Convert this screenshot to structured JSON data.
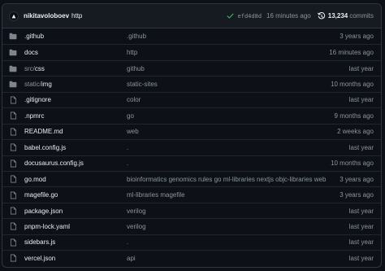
{
  "latest_commit": {
    "author": "nikitavoloboev",
    "message": "http",
    "sha": "efd4d8d",
    "time": "16 minutes ago",
    "commit_count": "13,234",
    "commits_label": "commits",
    "status": "success",
    "avatar_icon": "avatar-logo-icon",
    "history_icon": "history-clock-icon"
  },
  "colors": {
    "background": "#0d1117",
    "header": "#161b22",
    "border": "#30363d",
    "text": "#e6edf3",
    "muted": "#8b949e",
    "success": "#3fb950",
    "folder": "#7d8590"
  },
  "files": [
    {
      "type": "folder",
      "prefix": "",
      "name": ".github",
      "message": ".github",
      "age": "3 years ago"
    },
    {
      "type": "folder",
      "prefix": "",
      "name": "docs",
      "message": "http",
      "age": "16 minutes ago"
    },
    {
      "type": "folder",
      "prefix": "src/",
      "name": "css",
      "message": "github",
      "age": "last year"
    },
    {
      "type": "folder",
      "prefix": "static/",
      "name": "img",
      "message": "static-sites",
      "age": "10 months ago"
    },
    {
      "type": "file",
      "prefix": "",
      "name": ".gitignore",
      "message": "color",
      "age": "last year"
    },
    {
      "type": "file",
      "prefix": "",
      "name": ".npmrc",
      "message": "go",
      "age": "9 months ago"
    },
    {
      "type": "file",
      "prefix": "",
      "name": "README.md",
      "message": "web",
      "age": "2 weeks ago"
    },
    {
      "type": "file",
      "prefix": "",
      "name": "babel.config.js",
      "message": ".",
      "age": "last year"
    },
    {
      "type": "file",
      "prefix": "",
      "name": "docusaurus.config.js",
      "message": ".",
      "age": "10 months ago"
    },
    {
      "type": "file",
      "prefix": "",
      "name": "go.mod",
      "message": "bioinformatics genomics rules go ml-libraries nextjs objc-libraries web",
      "age": "3 years ago"
    },
    {
      "type": "file",
      "prefix": "",
      "name": "magefile.go",
      "message": "ml-libraries magefile",
      "age": "3 years ago"
    },
    {
      "type": "file",
      "prefix": "",
      "name": "package.json",
      "message": "verilog",
      "age": "last year"
    },
    {
      "type": "file",
      "prefix": "",
      "name": "pnpm-lock.yaml",
      "message": "verilog",
      "age": "last year"
    },
    {
      "type": "file",
      "prefix": "",
      "name": "sidebars.js",
      "message": ".",
      "age": "last year"
    },
    {
      "type": "file",
      "prefix": "",
      "name": "vercel.json",
      "message": "api",
      "age": "last year"
    }
  ]
}
